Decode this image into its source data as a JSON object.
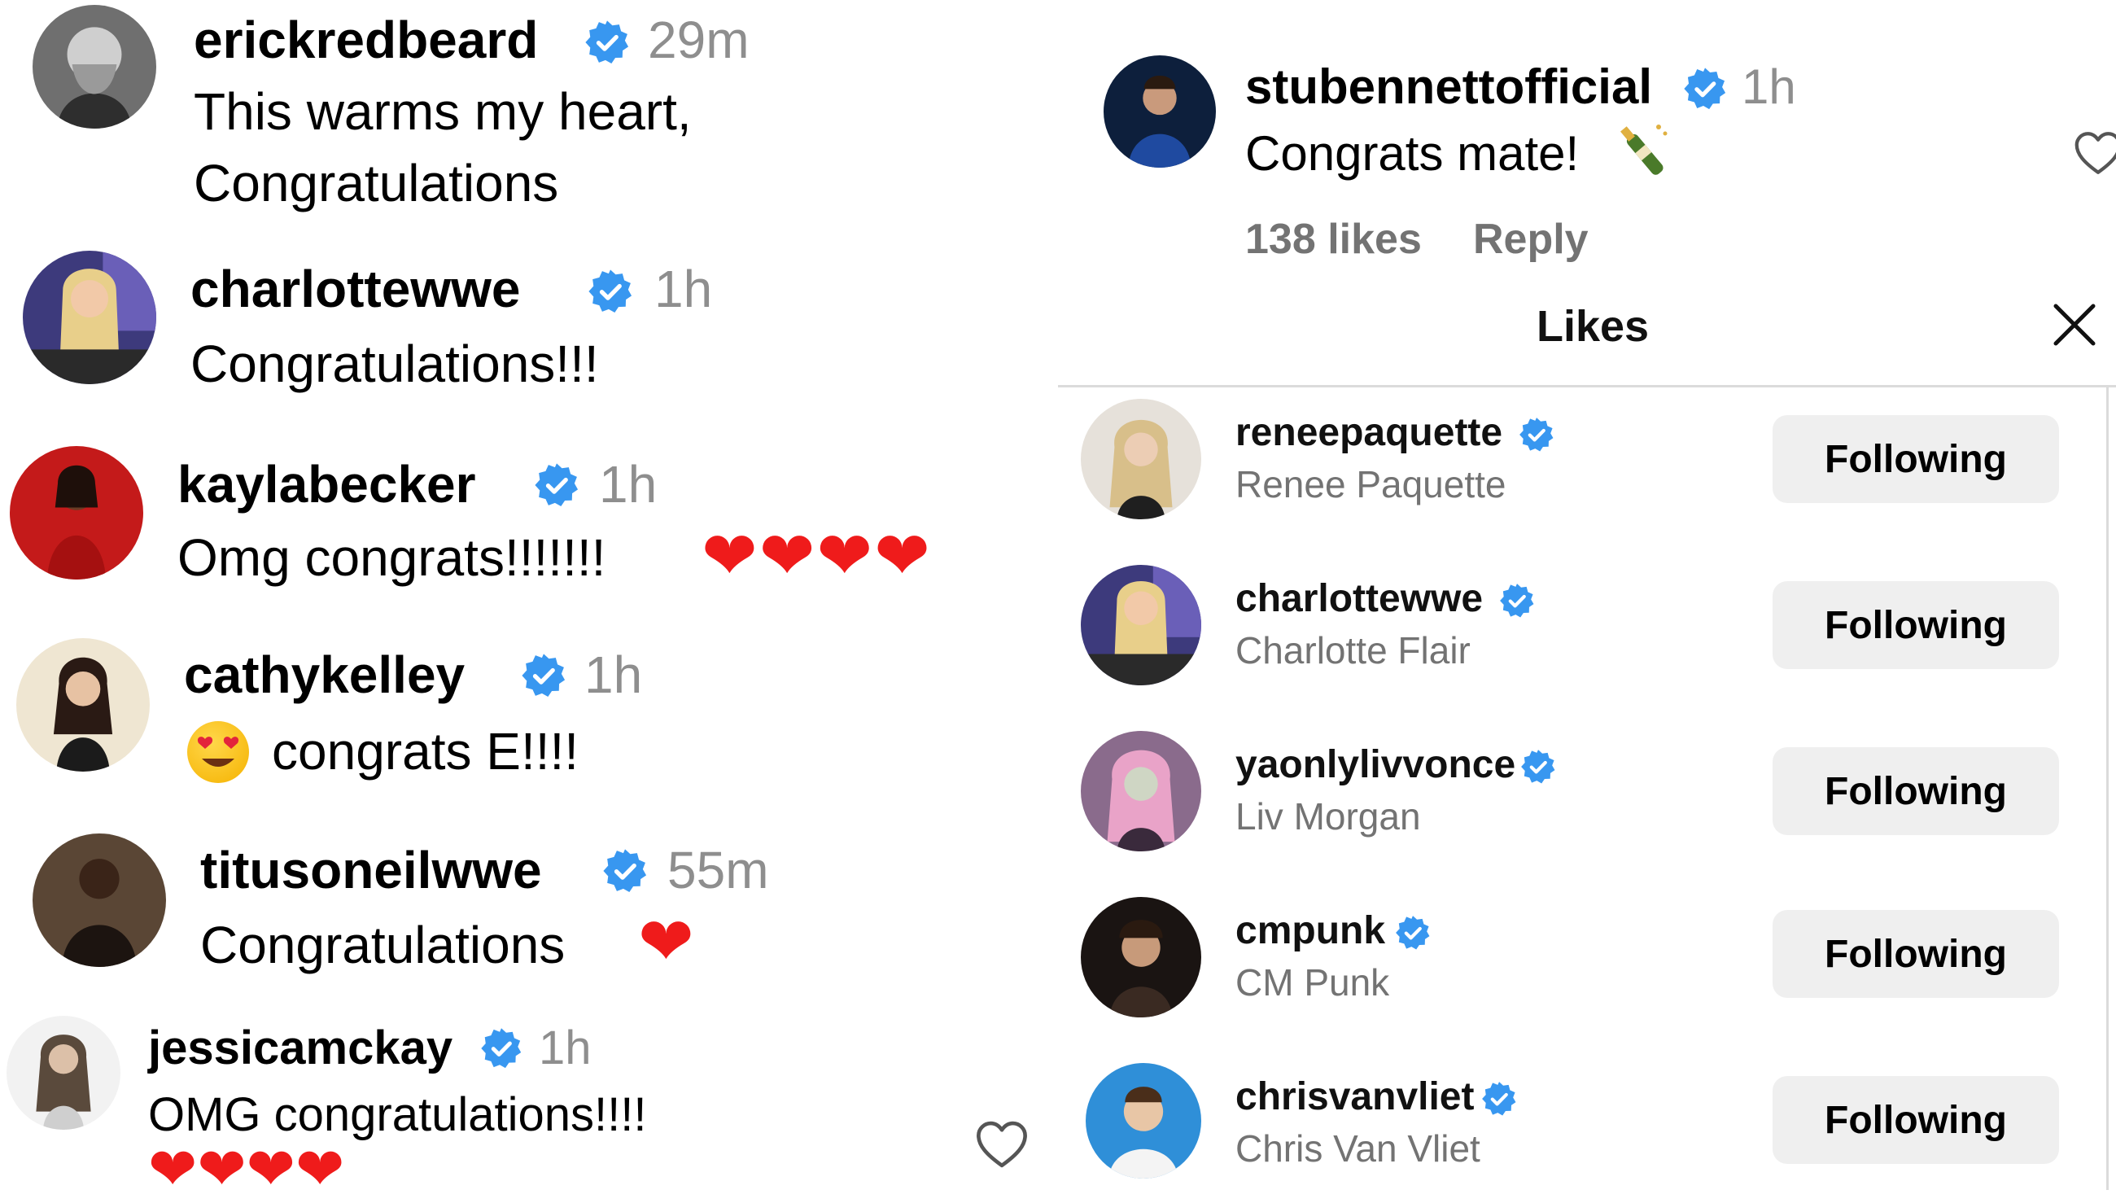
{
  "left_comments": [
    {
      "username": "erickredbeard",
      "time": "29m",
      "line1": "This warms my heart,",
      "line2": "Congratulations",
      "hearts": ""
    },
    {
      "username": "charlottewwe",
      "time": "1h",
      "line1": "Congratulations!!!",
      "line2": "",
      "hearts": ""
    },
    {
      "username": "kaylabecker",
      "time": "1h",
      "line1": "Omg congrats!!!!!!!",
      "line2": "",
      "hearts": "❤❤❤❤"
    },
    {
      "username": "cathykelley",
      "time": "1h",
      "line1": "congrats E!!!!",
      "line2": "",
      "hearts": ""
    },
    {
      "username": "titusoneilwwe",
      "time": "55m",
      "line1": "Congratulations",
      "line2": "",
      "hearts": "❤"
    },
    {
      "username": "jessicamckay",
      "time": "1h",
      "line1": "OMG congratulations!!!!",
      "line2": "",
      "hearts": "❤❤❤❤"
    }
  ],
  "right_comment": {
    "username": "stubennettofficial",
    "time": "1h",
    "text": "Congrats mate!",
    "likes": "138 likes",
    "reply": "Reply"
  },
  "likes_panel": {
    "title": "Likes",
    "close_icon": "close-icon",
    "users": [
      {
        "username": "reneepaquette",
        "fullname": "Renee Paquette",
        "button": "Following"
      },
      {
        "username": "charlottewwe",
        "fullname": "Charlotte Flair",
        "button": "Following"
      },
      {
        "username": "yaonlylivvonce",
        "fullname": "Liv Morgan",
        "button": "Following"
      },
      {
        "username": "cmpunk",
        "fullname": "CM Punk",
        "button": "Following"
      },
      {
        "username": "chrisvanvliet",
        "fullname": "Chris Van Vliet",
        "button": "Following"
      }
    ]
  },
  "colors": {
    "verified": "#3897f0",
    "heart": "#ef1b1b",
    "muted": "#8e8e8e",
    "button_bg": "#efefef"
  }
}
